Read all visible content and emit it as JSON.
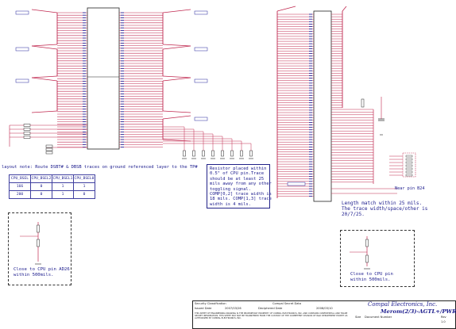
{
  "layout_note": "layout note: Route DSBT# & DBSB traces on ground referenced layer to the TP#",
  "bsel_table": {
    "headers": [
      "CPU_BSEL",
      "CPU_BSEL2",
      "CPU_BSEL1",
      "CPU_BSEL0"
    ],
    "rows": [
      [
        "166",
        "0",
        "1",
        "1"
      ],
      [
        "200",
        "0",
        "1",
        "0"
      ]
    ]
  },
  "resistor_note": "Resistor placed within\n0.5\" of CPU pin.Trace\nshould be at least 25\nmils away from any other\ntoggling signal.\nCOMP[0,2] trace width is\n18 mils. COMP[1,3] trace\nwidth is 4 mils.",
  "length_note": "Length match within 25 mils.\nThe trace width/space/other is\n20/7/25.",
  "close_note_left": "Close to CPU pin AD26\nwithin 500mils.",
  "close_note_right": "Close to CPU pin\nwithin 500mils.",
  "near_pin_label": "Near pin B24",
  "title_block": {
    "security_label": "Security Classification",
    "security_value": "Compal Secret Data",
    "issued_label": "Issued Date",
    "issued_value": "2007/03/26",
    "deciphered_label": "Deciphered Date",
    "deciphered_value": "2008/03/10",
    "company": "Compal Electronics, Inc.",
    "title": "Merom(2/3)-AGTL+/PWR",
    "size_label": "Size",
    "docnum_label": "Document Number",
    "rev_label": "Rev",
    "rev_value": "1.0",
    "legal_text": "THIS SHEET OF ENGINEERING DRAWING IS THE PROPRIETARY PROPERTY OF COMPAL ELECTRONICS, INC. AND CONTAINS CONFIDENTIAL AND TRADE SECRET INFORMATION. THIS SHEET MAY NOT BE TRANSFERED FROM THE CUSTODY OF THE COMPETENT DIVISION OF R&D DEPARTMENT EXCEPT AS AUTHORIZED BY COMPAL ELECTRONICS, INC."
  }
}
